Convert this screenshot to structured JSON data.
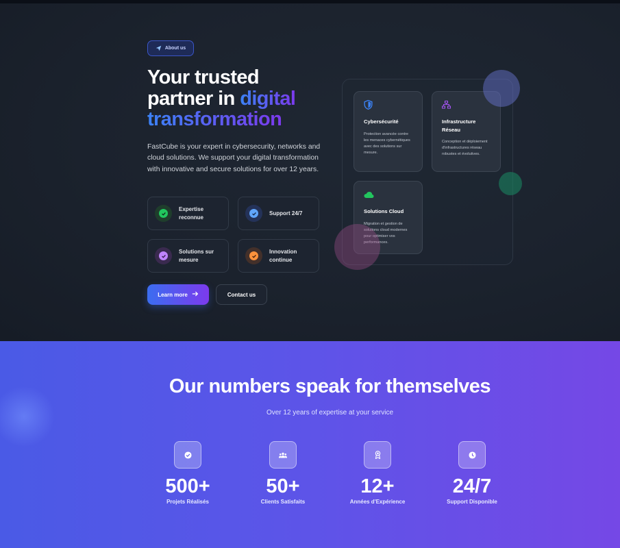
{
  "hero": {
    "about_label": "About us",
    "headline_line1": "Your trusted",
    "headline_line2_plain": "partner in ",
    "headline_line2_accent": "digital",
    "headline_line3_accent": "transformation",
    "intro": "FastCube is your expert in cybersecurity, networks and cloud solutions. We support your digital transformation with innovative and secure solutions for over 12 years.",
    "features": [
      {
        "label": "Expertise reconnue",
        "icon": "check-icon",
        "color": "#22c55e"
      },
      {
        "label": "Support 24/7",
        "icon": "check-icon",
        "color": "#60a5fa"
      },
      {
        "label": "Solutions sur mesure",
        "icon": "check-icon",
        "color": "#c084fc"
      },
      {
        "label": "Innovation continue",
        "icon": "check-icon",
        "color": "#fb923c"
      }
    ],
    "learn_more": "Learn more",
    "contact": "Contact us"
  },
  "services": [
    {
      "title": "Cybersécurité",
      "desc": "Protection avancée contre les menaces cybernétiques avec des solutions sur mesure.",
      "icon": "shield-icon",
      "color": "#3b82f6"
    },
    {
      "title": "Infrastructure Réseau",
      "desc": "Conception et déploiement d'infrastructures réseau robustes et évolutives.",
      "icon": "network-icon",
      "color": "#a855f7"
    },
    {
      "title": "Solutions Cloud",
      "desc": "Migration et gestion de solutions cloud modernes pour optimiser vos performances.",
      "icon": "cloud-icon",
      "color": "#22c55e"
    }
  ],
  "stats": {
    "title": "Our numbers speak for themselves",
    "subtitle": "Over 12 years of expertise at your service",
    "items": [
      {
        "number": "500+",
        "label": "Projets Réalisés",
        "icon": "check-circle-icon"
      },
      {
        "number": "50+",
        "label": "Clients Satisfaits",
        "icon": "users-icon"
      },
      {
        "number": "12+",
        "label": "Années d'Expérience",
        "icon": "award-icon"
      },
      {
        "number": "24/7",
        "label": "Support Disponible",
        "icon": "clock-icon"
      }
    ]
  }
}
